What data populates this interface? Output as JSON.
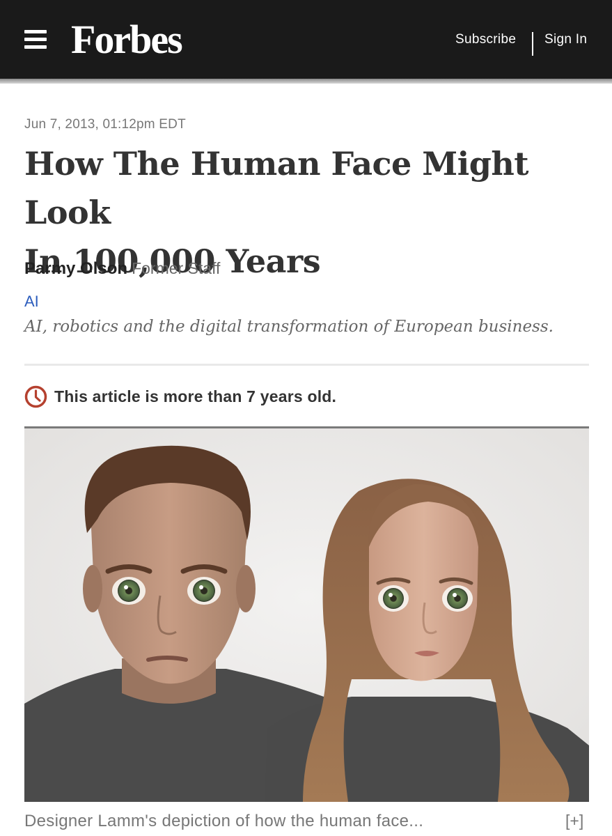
{
  "header": {
    "logo": "Forbes",
    "subscribe_label": "Subscribe",
    "signin_label": "Sign In"
  },
  "article": {
    "date": "Jun 7, 2013, 01:12pm EDT",
    "headline_line1": "How The Human Face Might Look",
    "headline_line2": "In 100,000 Years",
    "author": "Parmy Olson",
    "author_role": "Former Staff",
    "channel": "AI",
    "channel_description": "AI, robotics and the digital transformation of European business.",
    "age_notice": "This article is more than 7 years old.",
    "caption": "Designer Lamm's depiction of how the human face...",
    "caption_expand": "[+]"
  },
  "colors": {
    "header_bg": "#1a1a1a",
    "link_blue": "#2c5dbd",
    "notice_red": "#b5412f"
  },
  "icons": {
    "menu": "hamburger-menu-icon",
    "clock": "clock-icon"
  }
}
